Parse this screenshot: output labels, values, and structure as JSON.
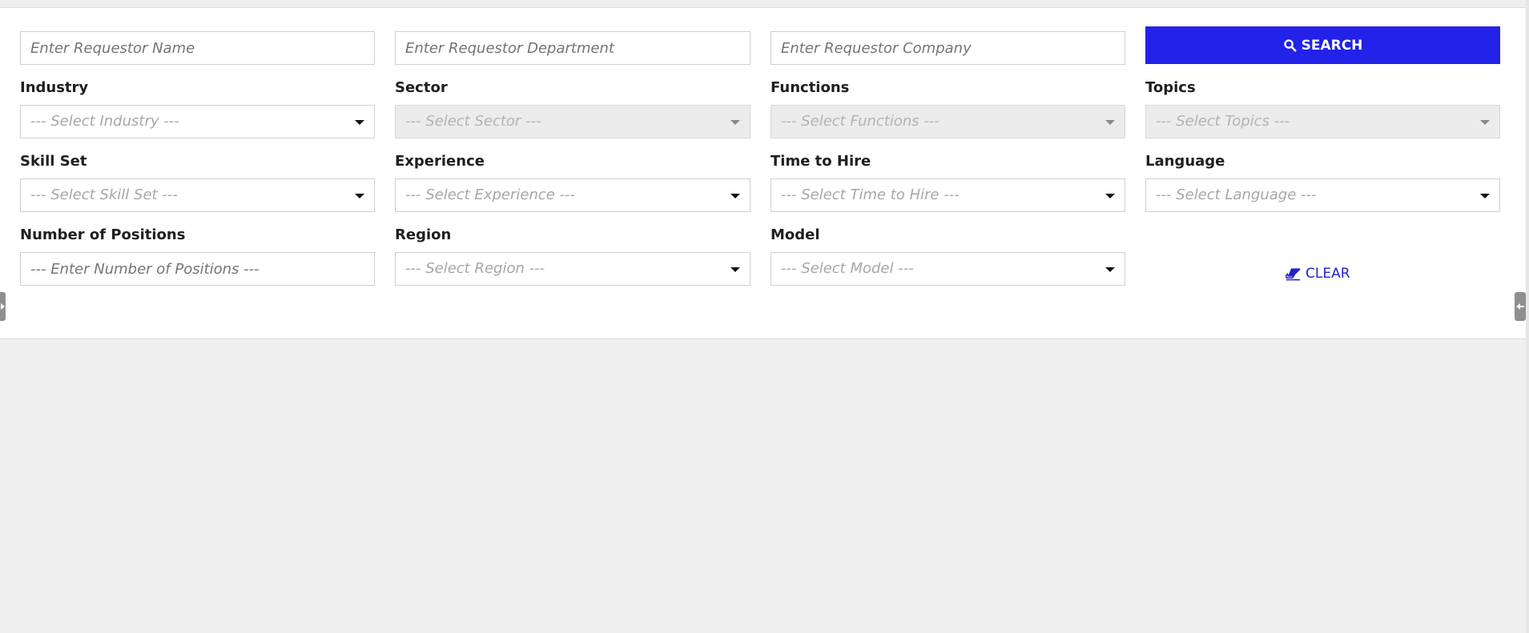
{
  "search_row": {
    "requestor_name_placeholder": "Enter Requestor Name",
    "requestor_department_placeholder": "Enter Requestor Department",
    "requestor_company_placeholder": "Enter Requestor Company",
    "search_label": "SEARCH"
  },
  "filters": {
    "industry": {
      "label": "Industry",
      "placeholder": "--- Select Industry ---",
      "disabled": false
    },
    "sector": {
      "label": "Sector",
      "placeholder": "--- Select Sector ---",
      "disabled": true
    },
    "functions": {
      "label": "Functions",
      "placeholder": "--- Select Functions ---",
      "disabled": true
    },
    "topics": {
      "label": "Topics",
      "placeholder": "--- Select Topics ---",
      "disabled": true
    },
    "skill_set": {
      "label": "Skill Set",
      "placeholder": "--- Select Skill Set ---",
      "disabled": false
    },
    "experience": {
      "label": "Experience",
      "placeholder": "--- Select Experience ---",
      "disabled": false
    },
    "time_to_hire": {
      "label": "Time to Hire",
      "placeholder": "--- Select Time to Hire ---",
      "disabled": false
    },
    "language": {
      "label": "Language",
      "placeholder": "--- Select Language ---",
      "disabled": false
    },
    "number_of_positions": {
      "label": "Number of Positions",
      "placeholder": "--- Enter Number of Positions ---"
    },
    "region": {
      "label": "Region",
      "placeholder": "--- Select Region ---",
      "disabled": false
    },
    "model": {
      "label": "Model",
      "placeholder": "--- Select Model ---",
      "disabled": false
    }
  },
  "clear_label": "CLEAR",
  "colors": {
    "accent": "#2222e8",
    "link": "#2222cc",
    "background": "#efefef",
    "panel": "#ffffff"
  },
  "icons": {
    "search": "search-icon",
    "clear": "eraser-icon",
    "dropdown": "chevron-down-icon",
    "left_handle": "collapse-left-icon",
    "right_handle": "collapse-right-icon"
  }
}
